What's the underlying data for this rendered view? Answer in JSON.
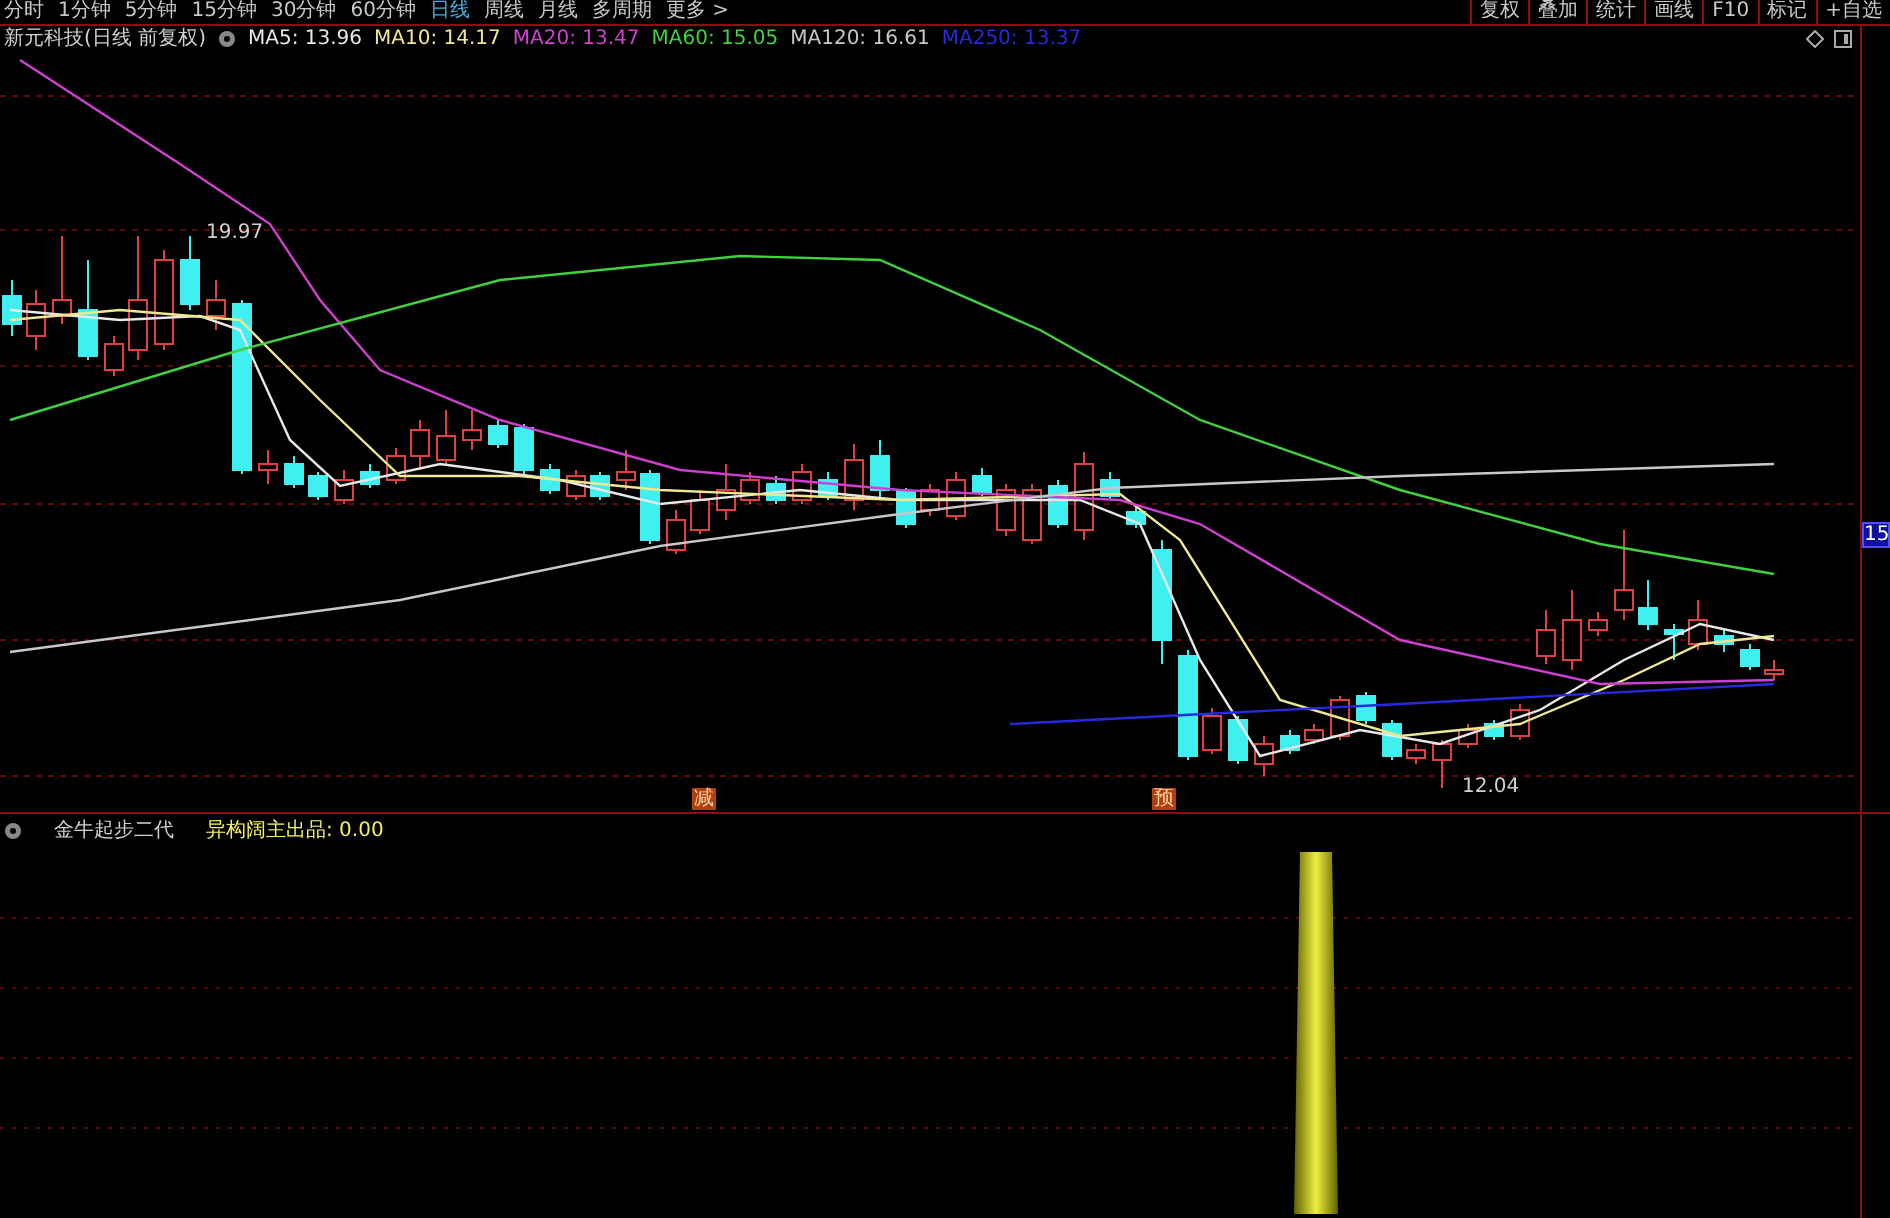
{
  "periods": [
    {
      "label": "分时",
      "selected": false
    },
    {
      "label": "1分钟",
      "selected": false
    },
    {
      "label": "5分钟",
      "selected": false
    },
    {
      "label": "15分钟",
      "selected": false
    },
    {
      "label": "30分钟",
      "selected": false
    },
    {
      "label": "60分钟",
      "selected": false
    },
    {
      "label": "日线",
      "selected": true
    },
    {
      "label": "周线",
      "selected": false
    },
    {
      "label": "月线",
      "selected": false
    },
    {
      "label": "多周期",
      "selected": false
    },
    {
      "label": "更多 >",
      "selected": false
    }
  ],
  "tools": [
    "复权",
    "叠加",
    "统计",
    "画线",
    "F10",
    "标记",
    "+自选"
  ],
  "main_chart": {
    "title": "新元科技(日线 前复权)",
    "averages": [
      {
        "label": "MA5: 13.96",
        "color": "#e8e8e8"
      },
      {
        "label": "MA10: 14.17",
        "color": "#f0e890"
      },
      {
        "label": "MA20: 13.47",
        "color": "#d040d0"
      },
      {
        "label": "MA60: 15.05",
        "color": "#40d040"
      },
      {
        "label": "MA120: 16.61",
        "color": "#c8c8c8"
      },
      {
        "label": "MA250: 13.37",
        "color": "#2828e0"
      }
    ],
    "high_label": "19.97",
    "low_label": "12.04",
    "axis_label": "15",
    "signals": [
      "减",
      "预"
    ]
  },
  "indicator": {
    "name": "金牛起步二代",
    "value": "异构阔主出品: 0.00"
  }
}
